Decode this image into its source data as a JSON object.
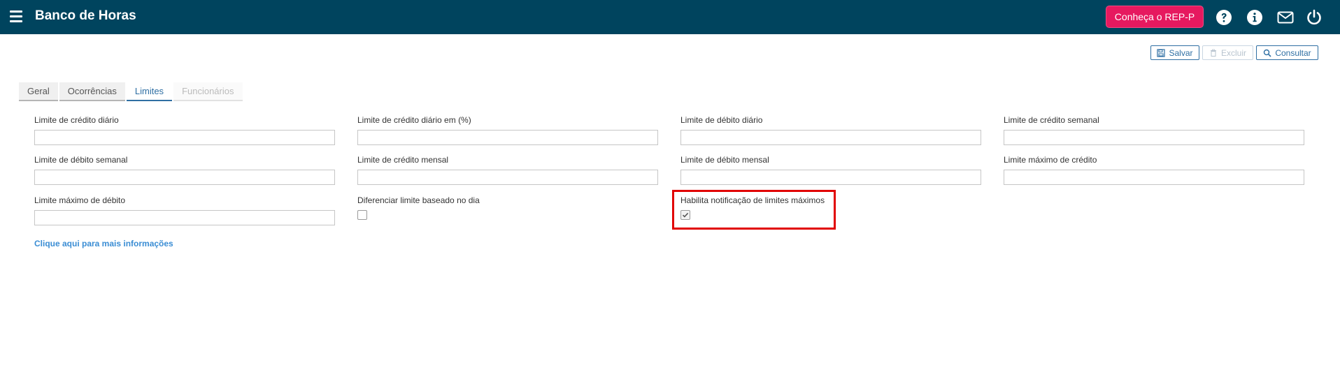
{
  "header": {
    "title": "Banco de Horas",
    "rep_button_label": "Conheça o REP-P",
    "icons": [
      "menu-icon",
      "help-icon",
      "info-icon",
      "mail-icon",
      "power-icon"
    ]
  },
  "toolbar": {
    "save_label": "Salvar",
    "delete_label": "Excluir",
    "query_label": "Consultar"
  },
  "tabs": [
    {
      "label": "Geral",
      "state": "normal"
    },
    {
      "label": "Ocorrências",
      "state": "normal"
    },
    {
      "label": "Limites",
      "state": "active"
    },
    {
      "label": "Funcionários",
      "state": "disabled"
    }
  ],
  "fields": {
    "limite_credito_diario": {
      "label": "Limite de crédito diário",
      "value": ""
    },
    "limite_credito_diario_pct": {
      "label": "Limite de crédito diário em (%)",
      "value": ""
    },
    "limite_debito_diario": {
      "label": "Limite de débito diário",
      "value": ""
    },
    "limite_credito_semanal": {
      "label": "Limite de crédito semanal",
      "value": ""
    },
    "limite_debito_semanal": {
      "label": "Limite de débito semanal",
      "value": ""
    },
    "limite_credito_mensal": {
      "label": "Limite de crédito mensal",
      "value": ""
    },
    "limite_debito_mensal": {
      "label": "Limite de débito mensal",
      "value": ""
    },
    "limite_maximo_credito": {
      "label": "Limite máximo de crédito",
      "value": ""
    },
    "limite_maximo_debito": {
      "label": "Limite máximo de débito",
      "value": ""
    }
  },
  "checkboxes": {
    "diferenciar_limite": {
      "label": "Diferenciar limite baseado no dia",
      "checked": false
    },
    "habilita_notificacao": {
      "label": "Habilita notificação de limites máximos",
      "checked": true
    }
  },
  "link": {
    "label": "Clique aqui para mais informações"
  },
  "colors": {
    "header_bg": "#00445e",
    "accent": "#2f6fa3",
    "rep_button": "#e6195f",
    "highlight": "#e10000",
    "link": "#3a8dd4"
  }
}
